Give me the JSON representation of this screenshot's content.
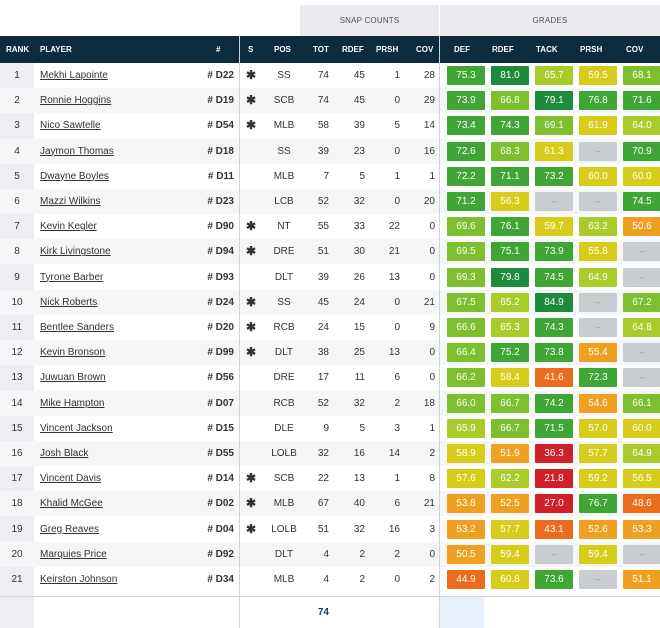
{
  "groups": {
    "snap": "SNAP COUNTS",
    "grades": "GRADES"
  },
  "headers": {
    "rank": "RANK",
    "player": "PLAYER",
    "num": "#",
    "s": "S",
    "pos": "POS",
    "tot": "TOT",
    "rdef": "RDEF",
    "prsh": "PRSH",
    "cov": "COV",
    "g_def": "DEF",
    "g_rdef": "RDEF",
    "g_tack": "TACK",
    "g_prsh": "PRSH",
    "g_cov": "COV"
  },
  "na_symbol": "–",
  "colors": {
    "dkgreen": "#1e8a3c",
    "green": "#3fa535",
    "ltgreen": "#7dbf2e",
    "lime": "#a8cc2a",
    "yellow": "#d8cc1a",
    "orange": "#f0a020",
    "dkorange": "#ea6c1c",
    "red": "#d0202a"
  },
  "rows": [
    {
      "rank": "1",
      "player": "Mekhi Lapointe",
      "num": "# D22",
      "star": "✱",
      "pos": "SS",
      "tot": "74",
      "rdef": "45",
      "prsh": "1",
      "cov": "28",
      "g": [
        "75.3",
        "81.0",
        "65.7",
        "59.5",
        "68.1"
      ],
      "c": [
        "green",
        "dkgreen",
        "lime",
        "yellow",
        "ltgreen"
      ]
    },
    {
      "rank": "2",
      "player": "Ronnie Hoggins",
      "num": "# D19",
      "star": "✱",
      "pos": "SCB",
      "tot": "74",
      "rdef": "45",
      "prsh": "0",
      "cov": "29",
      "g": [
        "73.9",
        "66.8",
        "79.1",
        "76.8",
        "71.6"
      ],
      "c": [
        "green",
        "ltgreen",
        "dkgreen",
        "green",
        "green"
      ]
    },
    {
      "rank": "3",
      "player": "Nico Sawtelle",
      "num": "# D54",
      "star": "✱",
      "pos": "MLB",
      "tot": "58",
      "rdef": "39",
      "prsh": "5",
      "cov": "14",
      "g": [
        "73.4",
        "74.3",
        "69.1",
        "61.9",
        "64.0"
      ],
      "c": [
        "green",
        "green",
        "ltgreen",
        "yellow",
        "lime"
      ]
    },
    {
      "rank": "4",
      "player": "Jaymon Thomas",
      "num": "# D18",
      "star": "",
      "pos": "SS",
      "tot": "39",
      "rdef": "23",
      "prsh": "0",
      "cov": "16",
      "g": [
        "72.6",
        "68.3",
        "61.3",
        "",
        "70.9"
      ],
      "c": [
        "green",
        "ltgreen",
        "yellow",
        "na",
        "green"
      ]
    },
    {
      "rank": "5",
      "player": "Dwayne Boyles",
      "num": "# D11",
      "star": "",
      "pos": "MLB",
      "tot": "7",
      "rdef": "5",
      "prsh": "1",
      "cov": "1",
      "g": [
        "72.2",
        "71.1",
        "73.2",
        "60.0",
        "60.0"
      ],
      "c": [
        "green",
        "green",
        "green",
        "yellow",
        "yellow"
      ]
    },
    {
      "rank": "6",
      "player": "Mazzi Wilkins",
      "num": "# D23",
      "star": "",
      "pos": "LCB",
      "tot": "52",
      "rdef": "32",
      "prsh": "0",
      "cov": "20",
      "g": [
        "71.2",
        "56.3",
        "",
        "",
        "74.5"
      ],
      "c": [
        "green",
        "yellow",
        "na",
        "na",
        "green"
      ]
    },
    {
      "rank": "7",
      "player": "Kevin Kegler",
      "num": "# D90",
      "star": "✱",
      "pos": "NT",
      "tot": "55",
      "rdef": "33",
      "prsh": "22",
      "cov": "0",
      "g": [
        "69.6",
        "76.1",
        "59.7",
        "63.2",
        "50.6"
      ],
      "c": [
        "ltgreen",
        "green",
        "yellow",
        "lime",
        "orange"
      ]
    },
    {
      "rank": "8",
      "player": "Kirk Livingstone",
      "num": "# D94",
      "star": "✱",
      "pos": "DRE",
      "tot": "51",
      "rdef": "30",
      "prsh": "21",
      "cov": "0",
      "g": [
        "69.5",
        "75.1",
        "73.9",
        "55.8",
        ""
      ],
      "c": [
        "ltgreen",
        "green",
        "green",
        "yellow",
        "na"
      ]
    },
    {
      "rank": "9",
      "player": "Tyrone Barber",
      "num": "# D93",
      "star": "",
      "pos": "DLT",
      "tot": "39",
      "rdef": "26",
      "prsh": "13",
      "cov": "0",
      "g": [
        "69.3",
        "79.8",
        "74.5",
        "64.9",
        ""
      ],
      "c": [
        "ltgreen",
        "dkgreen",
        "green",
        "lime",
        "na"
      ]
    },
    {
      "rank": "10",
      "player": "Nick Roberts",
      "num": "# D24",
      "star": "✱",
      "pos": "SS",
      "tot": "45",
      "rdef": "24",
      "prsh": "0",
      "cov": "21",
      "g": [
        "67.5",
        "65.2",
        "84.9",
        "",
        "67.2"
      ],
      "c": [
        "ltgreen",
        "lime",
        "dkgreen",
        "na",
        "ltgreen"
      ]
    },
    {
      "rank": "11",
      "player": "Bentlee Sanders",
      "num": "# D20",
      "star": "✱",
      "pos": "RCB",
      "tot": "24",
      "rdef": "15",
      "prsh": "0",
      "cov": "9",
      "g": [
        "66.6",
        "65.3",
        "74.3",
        "",
        "64.8"
      ],
      "c": [
        "ltgreen",
        "lime",
        "green",
        "na",
        "lime"
      ]
    },
    {
      "rank": "12",
      "player": "Kevin Bronson",
      "num": "# D99",
      "star": "✱",
      "pos": "DLT",
      "tot": "38",
      "rdef": "25",
      "prsh": "13",
      "cov": "0",
      "g": [
        "66.4",
        "75.2",
        "73.8",
        "55.4",
        ""
      ],
      "c": [
        "ltgreen",
        "green",
        "green",
        "orange",
        "na"
      ]
    },
    {
      "rank": "13",
      "player": "Juwuan Brown",
      "num": "# D56",
      "star": "",
      "pos": "DRE",
      "tot": "17",
      "rdef": "11",
      "prsh": "6",
      "cov": "0",
      "g": [
        "66.2",
        "58.4",
        "41.6",
        "72.3",
        ""
      ],
      "c": [
        "ltgreen",
        "yellow",
        "dkorange",
        "green",
        "na"
      ]
    },
    {
      "rank": "14",
      "player": "Mike Hampton",
      "num": "# D07",
      "star": "",
      "pos": "RCB",
      "tot": "52",
      "rdef": "32",
      "prsh": "2",
      "cov": "18",
      "g": [
        "66.0",
        "66.7",
        "74.2",
        "54.6",
        "66.1"
      ],
      "c": [
        "ltgreen",
        "ltgreen",
        "green",
        "orange",
        "ltgreen"
      ]
    },
    {
      "rank": "15",
      "player": "Vincent Jackson",
      "num": "# D15",
      "star": "",
      "pos": "DLE",
      "tot": "9",
      "rdef": "5",
      "prsh": "3",
      "cov": "1",
      "g": [
        "65.9",
        "66.7",
        "71.5",
        "57.0",
        "60.0"
      ],
      "c": [
        "lime",
        "ltgreen",
        "green",
        "yellow",
        "yellow"
      ]
    },
    {
      "rank": "16",
      "player": "Josh Black",
      "num": "# D55",
      "star": "",
      "pos": "LOLB",
      "tot": "32",
      "rdef": "16",
      "prsh": "14",
      "cov": "2",
      "g": [
        "58.9",
        "51.9",
        "36.3",
        "57.7",
        "64.9"
      ],
      "c": [
        "yellow",
        "orange",
        "red",
        "yellow",
        "lime"
      ]
    },
    {
      "rank": "17",
      "player": "Vincent Davis",
      "num": "# D14",
      "star": "✱",
      "pos": "SCB",
      "tot": "22",
      "rdef": "13",
      "prsh": "1",
      "cov": "8",
      "g": [
        "57.6",
        "62.2",
        "21.8",
        "59.2",
        "56.5"
      ],
      "c": [
        "yellow",
        "lime",
        "red",
        "yellow",
        "yellow"
      ]
    },
    {
      "rank": "18",
      "player": "Khalid McGee",
      "num": "# D02",
      "star": "✱",
      "pos": "MLB",
      "tot": "67",
      "rdef": "40",
      "prsh": "6",
      "cov": "21",
      "g": [
        "53.8",
        "52.5",
        "27.0",
        "76.7",
        "48.6"
      ],
      "c": [
        "orange",
        "orange",
        "red",
        "green",
        "dkorange"
      ]
    },
    {
      "rank": "19",
      "player": "Greg Reaves",
      "num": "# D04",
      "star": "✱",
      "pos": "LOLB",
      "tot": "51",
      "rdef": "32",
      "prsh": "16",
      "cov": "3",
      "g": [
        "53.2",
        "57.7",
        "43.1",
        "52.6",
        "53.3"
      ],
      "c": [
        "orange",
        "yellow",
        "dkorange",
        "orange",
        "orange"
      ]
    },
    {
      "rank": "20",
      "player": "Marquies Price",
      "num": "# D92",
      "star": "",
      "pos": "DLT",
      "tot": "4",
      "rdef": "2",
      "prsh": "2",
      "cov": "0",
      "g": [
        "50.5",
        "59.4",
        "",
        "59.4",
        ""
      ],
      "c": [
        "orange",
        "yellow",
        "na",
        "yellow",
        "na"
      ]
    },
    {
      "rank": "21",
      "player": "Keirston Johnson",
      "num": "# D34",
      "star": "",
      "pos": "MLB",
      "tot": "4",
      "rdef": "2",
      "prsh": "0",
      "cov": "2",
      "g": [
        "44.9",
        "60.8",
        "73.6",
        "",
        "51.1"
      ],
      "c": [
        "dkorange",
        "yellow",
        "green",
        "na",
        "orange"
      ]
    }
  ],
  "footer": {
    "tot_sum": "74"
  }
}
